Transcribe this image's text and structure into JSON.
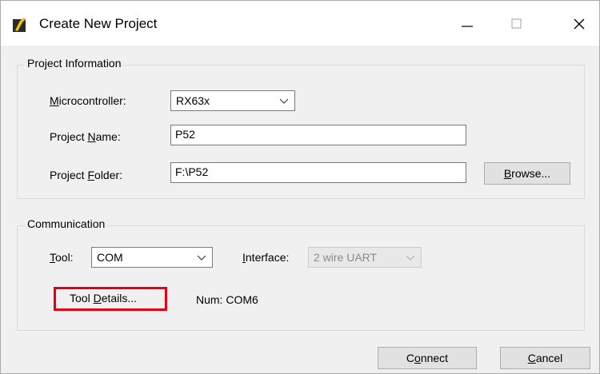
{
  "window": {
    "title": "Create New Project",
    "minimize_icon": "minimize-icon",
    "maximize_icon": "maximize-icon",
    "close_icon": "close-icon"
  },
  "project_info": {
    "group_label": "Project Information",
    "microcontroller": {
      "label_pre": "",
      "label_key": "M",
      "label_post": "icrocontroller:",
      "value": "RX63x"
    },
    "project_name": {
      "label_pre": "Project ",
      "label_key": "N",
      "label_post": "ame:",
      "value": "P52"
    },
    "project_folder": {
      "label_pre": "Project ",
      "label_key": "F",
      "label_post": "older:",
      "value": "F:\\P52"
    },
    "browse": {
      "label_key": "B",
      "label_post": "rowse..."
    }
  },
  "communication": {
    "group_label": "Communication",
    "tool": {
      "label_key": "T",
      "label_post": "ool:",
      "value": "COM"
    },
    "interface": {
      "label_key": "I",
      "label_post": "nterface:",
      "value": "2 wire UART"
    },
    "tool_details": {
      "label_pre": "Tool ",
      "label_key": "D",
      "label_post": "etails..."
    },
    "num_text": "Num: COM6"
  },
  "buttons": {
    "connect": {
      "label_pre": "C",
      "label_key": "o",
      "label_post": "nnect"
    },
    "cancel": {
      "label_key": "C",
      "label_post": "ancel"
    }
  },
  "colors": {
    "highlight": "#e30016"
  }
}
